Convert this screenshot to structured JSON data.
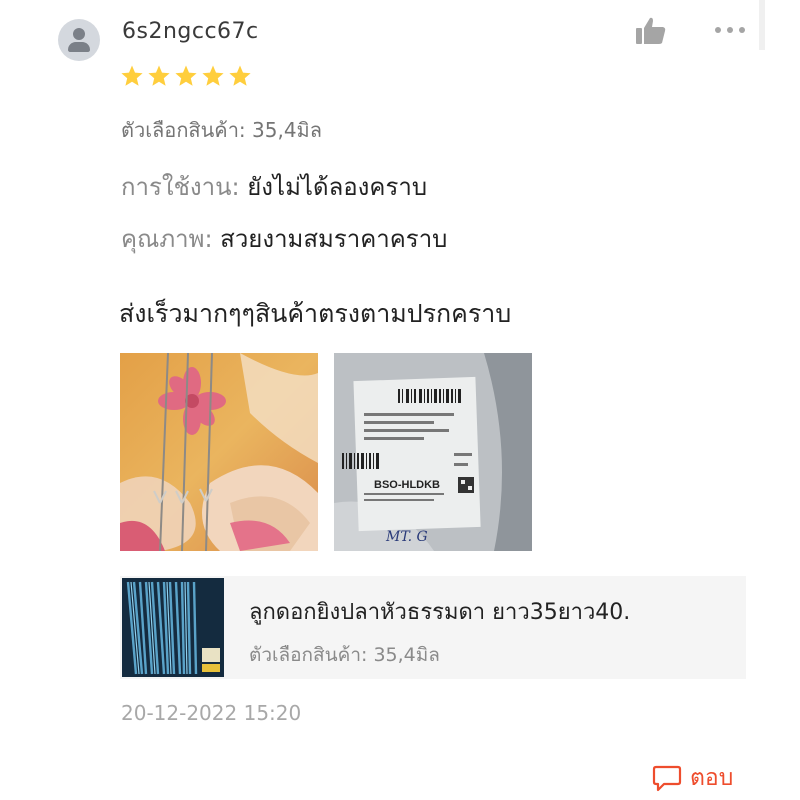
{
  "review": {
    "username": "6s2ngcc67c",
    "rating": 5,
    "variation": "ตัวเลือกสินค้า: 35,4มิล",
    "attributes": [
      {
        "label": "การใช้งาน:",
        "value": "ยังไม่ได้ลองคราบ"
      },
      {
        "label": "คุณภาพ:",
        "value": "สวยงามสมราคาคราบ"
      }
    ],
    "comment": "ส่งเร็วมากๆๆสินค้าตรงตามปรกคราบ",
    "timestamp": "20-12-2022 15:20"
  },
  "photos": {
    "photo2_label_code": "BSO-HLDKB",
    "photo2_handwriting": "MT. G"
  },
  "product": {
    "name": "ลูกดอกยิงปลาหัวธรรมดา ยาว35ยาว40.",
    "variation": "ตัวเลือกสินค้า: 35,4มิล"
  },
  "actions": {
    "reply_label": "ตอบ"
  },
  "icons": {
    "like": "thumbs-up-icon",
    "more": "more-options-icon",
    "reply": "chat-bubble-icon",
    "avatar": "user-avatar-icon"
  },
  "colors": {
    "star": "#ffce3d",
    "accent": "#ee4d2d",
    "icon_gray": "#a0a0a0"
  }
}
